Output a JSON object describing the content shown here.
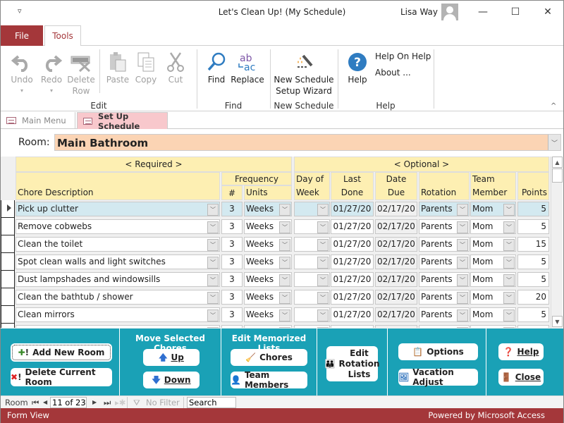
{
  "window": {
    "title": "Let's Clean Up! (My Schedule)",
    "user_name": "Lisa Way",
    "qat_icon": "customize-quick-access-icon",
    "minimize": "—",
    "maximize": "☐",
    "close": "✕"
  },
  "ribbon_tabs": [
    {
      "label": "File"
    },
    {
      "label": "Tools",
      "active": true
    }
  ],
  "ribbon": {
    "groups": {
      "edit": "Edit",
      "find": "Find",
      "new_schedule": "New Schedule",
      "help": "Help"
    },
    "buttons": {
      "undo": "Undo",
      "redo": "Redo",
      "delete_row_1": "Delete",
      "delete_row_2": "Row",
      "paste": "Paste",
      "copy": "Copy",
      "cut": "Cut",
      "find": "Find",
      "replace": "Replace",
      "wizard_1": "New Schedule",
      "wizard_2": "Setup Wizard",
      "help": "Help",
      "help_on_help": "Help On Help",
      "about": "About ..."
    },
    "disabled": [
      "undo",
      "redo",
      "delete_row",
      "paste",
      "copy",
      "cut"
    ],
    "collapse_icon": "^"
  },
  "doc_tabs": [
    {
      "label": "Main Menu",
      "active": false
    },
    {
      "label": "Set Up Schedule",
      "active": true
    }
  ],
  "form": {
    "room_label": "Room:",
    "room_value": "Main Bathroom",
    "headers": {
      "required": "<   Required   >",
      "optional": "<   Optional   >",
      "chore_description": "Chore Description",
      "frequency": "Frequency",
      "num": "#",
      "units": "Units",
      "day_of_week_1": "Day of",
      "day_of_week_2": "Week",
      "last_done_1": "Last",
      "last_done_2": "Done",
      "date_due_1": "Date",
      "date_due_2": "Due",
      "rotation": "Rotation",
      "team_member_1": "Team",
      "team_member_2": "Member",
      "points": "Points"
    },
    "rows": [
      {
        "chore": "Pick up clutter",
        "num": "3",
        "units": "Weeks",
        "day": "",
        "last_done": "01/27/20",
        "date_due": "02/17/20",
        "rotation": "Parents",
        "member": "Mom",
        "points": "5",
        "current": true
      },
      {
        "chore": "Remove cobwebs",
        "num": "3",
        "units": "Weeks",
        "day": "",
        "last_done": "01/27/20",
        "date_due": "02/17/20",
        "rotation": "Parents",
        "member": "Mom",
        "points": "5"
      },
      {
        "chore": "Clean the toilet",
        "num": "3",
        "units": "Weeks",
        "day": "",
        "last_done": "01/27/20",
        "date_due": "02/17/20",
        "rotation": "Parents",
        "member": "Mom",
        "points": "15"
      },
      {
        "chore": "Spot clean walls and light switches",
        "num": "3",
        "units": "Weeks",
        "day": "",
        "last_done": "01/27/20",
        "date_due": "02/17/20",
        "rotation": "Parents",
        "member": "Mom",
        "points": "5"
      },
      {
        "chore": "Dust lampshades and windowsills",
        "num": "3",
        "units": "Weeks",
        "day": "",
        "last_done": "01/27/20",
        "date_due": "02/17/20",
        "rotation": "Parents",
        "member": "Mom",
        "points": "5"
      },
      {
        "chore": "Clean the bathtub / shower",
        "num": "3",
        "units": "Weeks",
        "day": "",
        "last_done": "01/27/20",
        "date_due": "02/17/20",
        "rotation": "Parents",
        "member": "Mom",
        "points": "20"
      },
      {
        "chore": "Clean mirrors",
        "num": "3",
        "units": "Weeks",
        "day": "",
        "last_done": "01/27/20",
        "date_due": "02/17/20",
        "rotation": "Parents",
        "member": "Mom",
        "points": "5"
      },
      {
        "chore": "",
        "num": "",
        "units": "",
        "day": "",
        "last_done": "",
        "date_due": "",
        "rotation": "",
        "member": "",
        "points": "",
        "partial": true
      }
    ]
  },
  "panel": {
    "add_room": "Add New Room",
    "delete_room": "Delete Current Room",
    "move_title": "Move Selected Chores",
    "up": "Up",
    "down": "Down",
    "lists_title": "Edit Memorized Lists",
    "chores": "Chores",
    "team_members": "Team Members",
    "rotation_1": "Edit",
    "rotation_2": "Rotation",
    "rotation_3": "Lists",
    "options": "Options",
    "vacation": "Vacation Adjust",
    "help": "Help",
    "close": "Close"
  },
  "navbar": {
    "label": "Room",
    "record": "11 of 23",
    "filter": "No Filter",
    "search": "Search"
  },
  "status": {
    "left": "Form View",
    "right": "Powered by Microsoft Access"
  },
  "colors": {
    "brand_red": "#a4373a",
    "panel_teal": "#1aa1b6",
    "header_yellow": "#fdefb2",
    "room_combo": "#fbd4b4",
    "current_row": "#d3e9f0",
    "active_doc_tab": "#f8c8cc"
  }
}
